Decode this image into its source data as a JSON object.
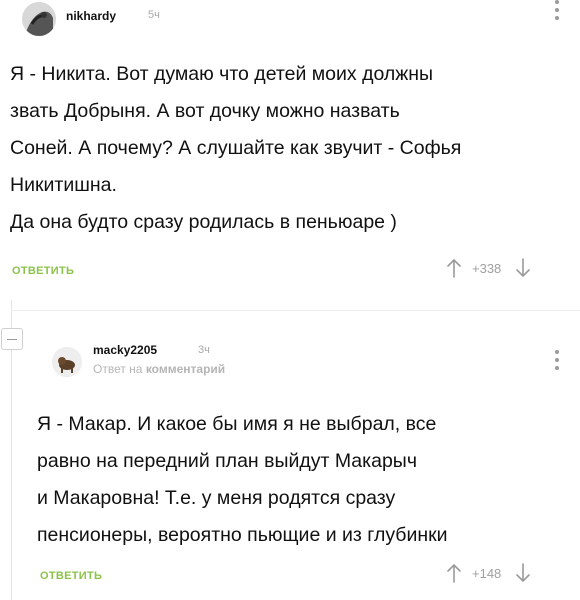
{
  "comments": [
    {
      "username": "nikhardy",
      "time": "5ч",
      "lines": [
        "Я - Никита. Вот думаю что детей моих должны",
        "звать Добрыня. А вот дочку можно назвать",
        "Соней. А почему? А слушайте как звучит - Софья",
        "Никитишна.",
        "Да она будто сразу родилась в пеньюаре )"
      ],
      "reply_label": "ОТВЕТИТЬ",
      "rating": "+338"
    },
    {
      "username": "macky2205",
      "time": "3ч",
      "reply_to_prefix": "Ответ на",
      "reply_to_target": "комментарий",
      "lines": [
        "Я - Макар. И какое бы имя я не выбрал, все",
        "равно на передний план выйдут Макарыч",
        "и Макаровна! Т.е. у меня родятся сразу",
        "пенсионеры, вероятно пьющие и из глубинки"
      ],
      "reply_label": "ОТВЕТИТЬ",
      "rating": "+148"
    }
  ],
  "icons": {
    "upvote": "arrow-up-icon",
    "downvote": "arrow-down-icon",
    "menu": "more-vertical-icon",
    "collapse": "minus-icon"
  },
  "colors": {
    "accent": "#8bc34a",
    "muted": "#a0a0a0"
  }
}
